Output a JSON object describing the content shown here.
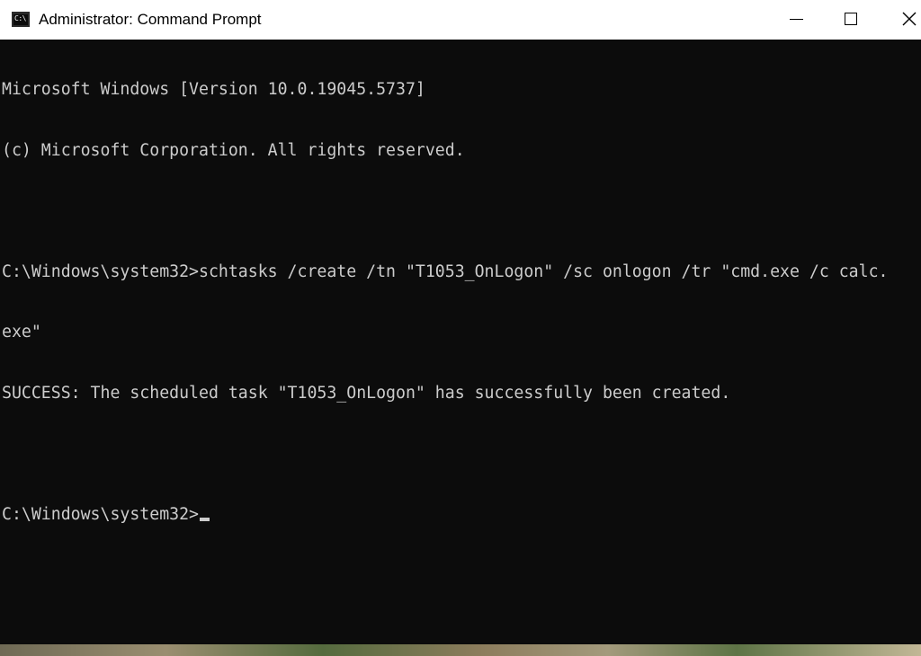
{
  "window": {
    "title": "Administrator: Command Prompt",
    "app_icon_text": "C:\\"
  },
  "controls": {
    "minimize": "minimize",
    "maximize": "maximize",
    "close": "close"
  },
  "console": {
    "lines": [
      "Microsoft Windows [Version 10.0.19045.5737]",
      "(c) Microsoft Corporation. All rights reserved.",
      "",
      "C:\\Windows\\system32>schtasks /create /tn \"T1053_OnLogon\" /sc onlogon /tr \"cmd.exe /c calc.",
      "exe\"",
      "SUCCESS: The scheduled task \"T1053_OnLogon\" has successfully been created.",
      "",
      "C:\\Windows\\system32>"
    ]
  },
  "colors": {
    "console_bg": "#0c0c0c",
    "console_fg": "#cccccc",
    "titlebar_bg": "#ffffff"
  }
}
